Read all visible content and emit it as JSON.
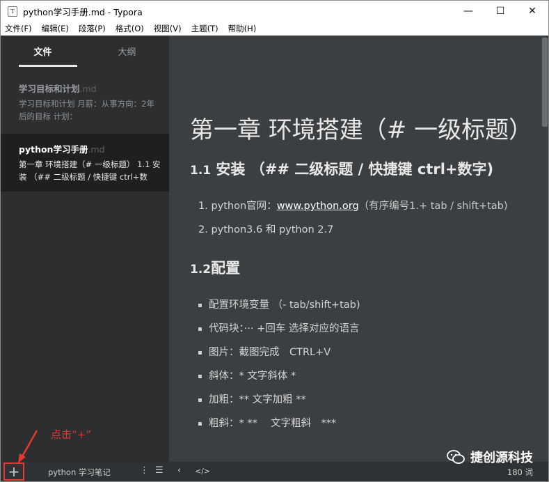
{
  "window": {
    "title": "python学习手册.md - Typora",
    "app_icon_letter": "T",
    "controls": {
      "minimize": "—",
      "maximize": "☐",
      "close": "✕"
    }
  },
  "menu": {
    "items": [
      "文件(F)",
      "编辑(E)",
      "段落(P)",
      "格式(O)",
      "视图(V)",
      "主题(T)",
      "帮助(H)"
    ]
  },
  "sidebar": {
    "tabs": [
      {
        "label": "文件",
        "active": true
      },
      {
        "label": "大纲",
        "active": false
      }
    ],
    "files": [
      {
        "name": "学习目标和计划",
        "ext": ".md",
        "snippet": "学习目标和计划 月薪：从事方向：2年后的目标 计划：",
        "active": false
      },
      {
        "name": "python学习手册",
        "ext": ".md",
        "snippet": "第一章 环境搭建（# 一级标题） 1.1 安装 （## 二级标题 / 快捷键 ctrl+数",
        "active": true
      }
    ]
  },
  "editor": {
    "h1": "第一章 环境搭建（# 一级标题）",
    "sections": [
      {
        "heading_num": "1.1",
        "heading_text": " 安装 （## 二级标题 / 快捷键 ctrl+数字)",
        "ordered_items": [
          {
            "num": "1.",
            "prefix": "python官网：",
            "link": "www.python.org",
            "suffix": "（有序编号1.+ tab / shift+tab)"
          },
          {
            "num": "2.",
            "prefix": "python3.6 和 python 2.7",
            "link": "",
            "suffix": ""
          }
        ]
      },
      {
        "heading_num": "1.2",
        "heading_text": "配置",
        "bullet_items": [
          "配置环境变量 （- tab/shift+tab)",
          "代码块：··· +回车 选择对应的语言",
          "图片：截图完成　CTRL+V",
          "斜体：* 文字斜体 *",
          "加粗：** 文字加粗 **",
          "粗斜：* ** 　文字粗斜　***"
        ]
      }
    ]
  },
  "statusbar": {
    "add_label": "+",
    "folder_name": "python 学习笔记",
    "more_icon": "⋮",
    "outline_icon": "☰",
    "back_icon": "‹",
    "source_icon": "</>",
    "word_count": "180 词"
  },
  "annotation": {
    "text": "点击“+”",
    "color": "#e53935"
  },
  "watermark": {
    "text": "捷创源科技"
  }
}
